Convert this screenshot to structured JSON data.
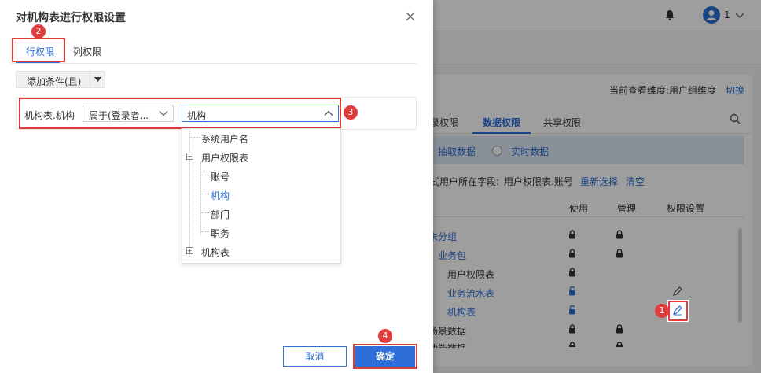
{
  "background": {
    "user_number": "1",
    "dimension_label": "当前查看维度:用户组维度",
    "switch_label": "切换",
    "tabs": [
      "录权限",
      "数据权限",
      "共享权限"
    ],
    "filter": {
      "option_extract": "抽取数据",
      "option_realtime": "实时数据"
    },
    "field_prefix": "式用户所在字段:",
    "field_value": "用户权限表.账号",
    "reselect": "重新选择",
    "clear": "清空",
    "columns": [
      "使用",
      "管理",
      "权限设置"
    ],
    "rows": [
      {
        "label": "未分组"
      },
      {
        "label": "业务包"
      },
      {
        "label": "用户权限表"
      },
      {
        "label": "业务流水表"
      },
      {
        "label": "机构表"
      },
      {
        "label": "场景数据"
      },
      {
        "label": "功能数据"
      }
    ]
  },
  "dialog": {
    "title": "对机构表进行权限设置",
    "tabs": {
      "row": "行权限",
      "col": "列权限"
    },
    "add_condition": "添加条件(且)",
    "condition": {
      "field": "机构表.机构",
      "operator": "属于(登录者...",
      "value": "机构"
    },
    "tree": [
      {
        "label": "系统用户名"
      },
      {
        "label": "用户权限表",
        "expander": "−"
      },
      {
        "label": "账号"
      },
      {
        "label": "机构",
        "selected": true
      },
      {
        "label": "部门"
      },
      {
        "label": "职务"
      },
      {
        "label": "机构表",
        "expander": "+"
      }
    ],
    "cancel": "取消",
    "ok": "确定"
  },
  "badges": [
    "1",
    "2",
    "3",
    "4"
  ],
  "colors": {
    "accent": "#2d6fd6",
    "highlight": "#e03c3c"
  }
}
